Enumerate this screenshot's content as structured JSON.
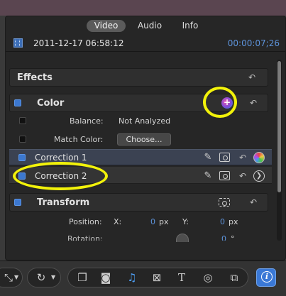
{
  "tabs": [
    {
      "label": "Video",
      "active": true
    },
    {
      "label": "Audio",
      "active": false
    },
    {
      "label": "Info",
      "active": false
    }
  ],
  "clip": {
    "date": "2011-12-17 06:58:12",
    "timecode": "00:00:07;26"
  },
  "effects": {
    "title": "Effects",
    "reset_icon": "reset-arrow-icon"
  },
  "color": {
    "title": "Color",
    "enabled": true,
    "add_icon": "add-color-correction-icon",
    "balance": {
      "label": "Balance:",
      "value": "Not Analyzed"
    },
    "match_color": {
      "label": "Match Color:",
      "button": "Choose..."
    },
    "corrections": [
      {
        "label": "Correction 1",
        "selected": true
      },
      {
        "label": "Correction 2",
        "selected": false
      }
    ]
  },
  "transform": {
    "title": "Transform",
    "position": {
      "label": "Position:",
      "x_label": "X:",
      "x_value": "0",
      "x_unit": "px",
      "y_label": "Y:",
      "y_value": "0",
      "y_unit": "px"
    },
    "rotation": {
      "label": "Rotation:",
      "value": "0",
      "unit": "°"
    }
  },
  "toolbar": {
    "icons": [
      "crop-icon",
      "rotate-icon",
      "clip-browser-icon",
      "photo-icon",
      "music-icon",
      "transitions-icon",
      "titles-icon",
      "generators-icon",
      "themes-icon",
      "info-icon"
    ],
    "info_label": "i"
  },
  "colors": {
    "accent_blue": "#3c78d0",
    "timecode_blue": "#5d93da",
    "highlight_yellow": "#f2f20a"
  }
}
